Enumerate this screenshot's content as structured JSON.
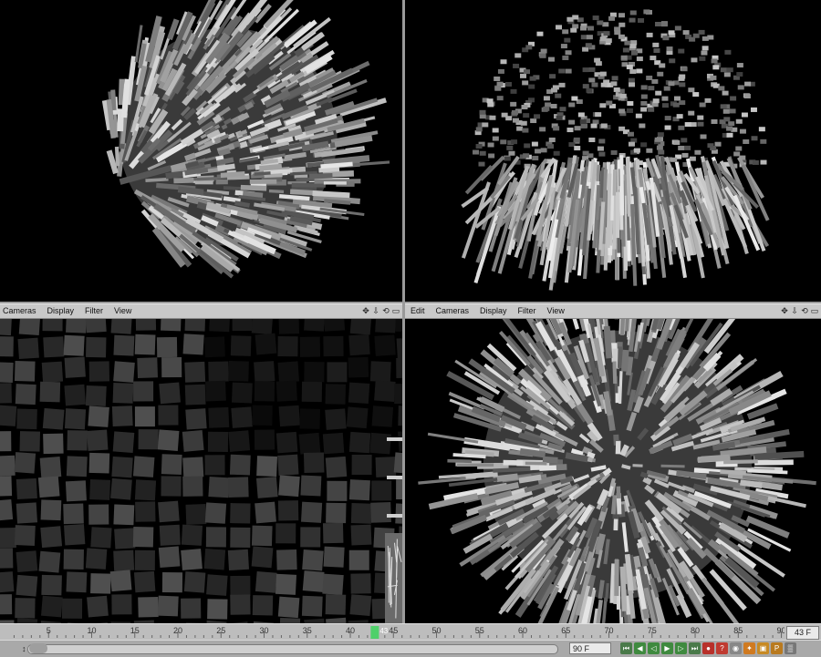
{
  "viewports": {
    "bottom_left": {
      "menu": [
        "Cameras",
        "Display",
        "Filter",
        "View"
      ]
    },
    "bottom_right": {
      "menu": [
        "Edit",
        "Cameras",
        "Display",
        "Filter",
        "View"
      ]
    },
    "nav_icons": [
      "move-icon",
      "zoom-icon",
      "rotate-icon",
      "maximize-icon"
    ]
  },
  "timeline": {
    "ticks": [
      "5",
      "10",
      "15",
      "20",
      "25",
      "30",
      "35",
      "40",
      "45",
      "50",
      "55",
      "60",
      "65",
      "70",
      "75",
      "80",
      "85",
      "90"
    ],
    "current_frame_label": "43",
    "current_frame": 43,
    "frame_display": "43 F"
  },
  "controls": {
    "start_marker": "↕",
    "end_frame": "90 F",
    "buttons": [
      {
        "name": "go-start-icon",
        "glyph": "⏮",
        "color": "#4a7a4a"
      },
      {
        "name": "step-back-icon",
        "glyph": "◀",
        "color": "#3f8a3f"
      },
      {
        "name": "play-back-icon",
        "glyph": "◁",
        "color": "#3f8a3f"
      },
      {
        "name": "play-icon",
        "glyph": "▶",
        "color": "#3f8a3f"
      },
      {
        "name": "step-forward-icon",
        "glyph": "▷",
        "color": "#3f8a3f"
      },
      {
        "name": "go-end-icon",
        "glyph": "⏭",
        "color": "#4a7a4a"
      },
      {
        "name": "record-icon",
        "glyph": "●",
        "color": "#b8302a"
      },
      {
        "name": "help-icon",
        "glyph": "?",
        "color": "#c03a30"
      },
      {
        "name": "keyframe-icon",
        "glyph": "◉",
        "color": "#888"
      },
      {
        "name": "key-select-icon",
        "glyph": "✦",
        "color": "#d07a20"
      },
      {
        "name": "key-auto-icon",
        "glyph": "▣",
        "color": "#c78a24"
      },
      {
        "name": "key-pos-icon",
        "glyph": "P",
        "color": "#b97a1f"
      },
      {
        "name": "key-grid-icon",
        "glyph": "▒",
        "color": "#777"
      }
    ]
  }
}
